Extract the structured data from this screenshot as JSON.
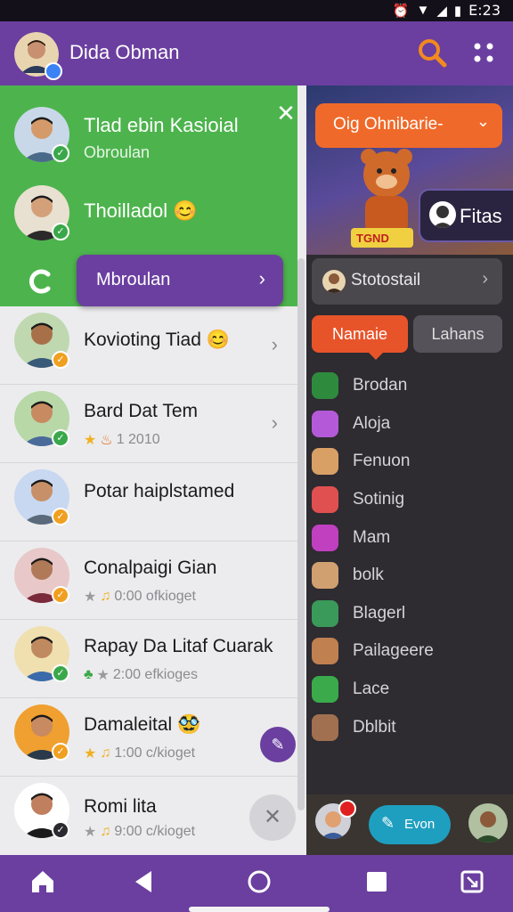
{
  "status_bar": {
    "time": "E:23",
    "icons": [
      "alarm-icon",
      "wifi-icon",
      "signal-icon",
      "battery-icon"
    ]
  },
  "topbar": {
    "title": "Dida Obman",
    "icons": [
      "search-icon",
      "more-icon"
    ]
  },
  "drawer": {
    "green": {
      "user1": {
        "name": "Tlad ebin Kasioial",
        "sub": "Obroulan"
      },
      "user2": {
        "name": "Thoilladol 😊"
      },
      "selector": "Mbroulan"
    },
    "contacts": [
      {
        "name": "Kovioting Tiad 😊",
        "meta": "",
        "badge": "orange",
        "chevron": true
      },
      {
        "name": "Bard Dat Tem",
        "meta": "1 2010",
        "badge": "green",
        "chevron": true
      },
      {
        "name": "Potar haiplstamed",
        "meta": "",
        "badge": "orange",
        "chevron": false
      },
      {
        "name": "Conalpaigi Gian",
        "meta": "0:00 ofkioget",
        "badge": "orange",
        "chevron": false
      },
      {
        "name": "Rapay Da Litaf Cuarak",
        "meta": "2:00 efkioges",
        "badge": "green",
        "chevron": false
      },
      {
        "name": "Damaleital 🥸",
        "meta": "1:00 c/kioget",
        "badge": "orange",
        "chevron": false
      },
      {
        "name": "Romi lita",
        "meta": "9:00 c/kioget",
        "badge": "dark",
        "chevron": false
      }
    ]
  },
  "right_panel": {
    "dropdown": "Oig Ohnibarie-",
    "card_label": "Fitas",
    "sign_text": "TGND",
    "search_label": "Stotostail",
    "tabs": [
      "Namaie",
      "Lahans"
    ],
    "items": [
      "Brodan",
      "Aloja",
      "Fenuon",
      "Sotinig",
      "Mam",
      "bolk",
      "Blagerl",
      "Pailageere",
      "Lace",
      "Dblbit"
    ],
    "item_colors": [
      "#2e8b3e",
      "#b45ad8",
      "#d9a066",
      "#e05050",
      "#c040c0",
      "#d0a070",
      "#3a9a5a",
      "#c08050",
      "#3aaa4a",
      "#a07050"
    ],
    "action_label": "Evon"
  },
  "colors": {
    "brand_purple": "#6b3fa0",
    "drawer_green": "#4db44d",
    "accent_orange": "#e8542a"
  }
}
